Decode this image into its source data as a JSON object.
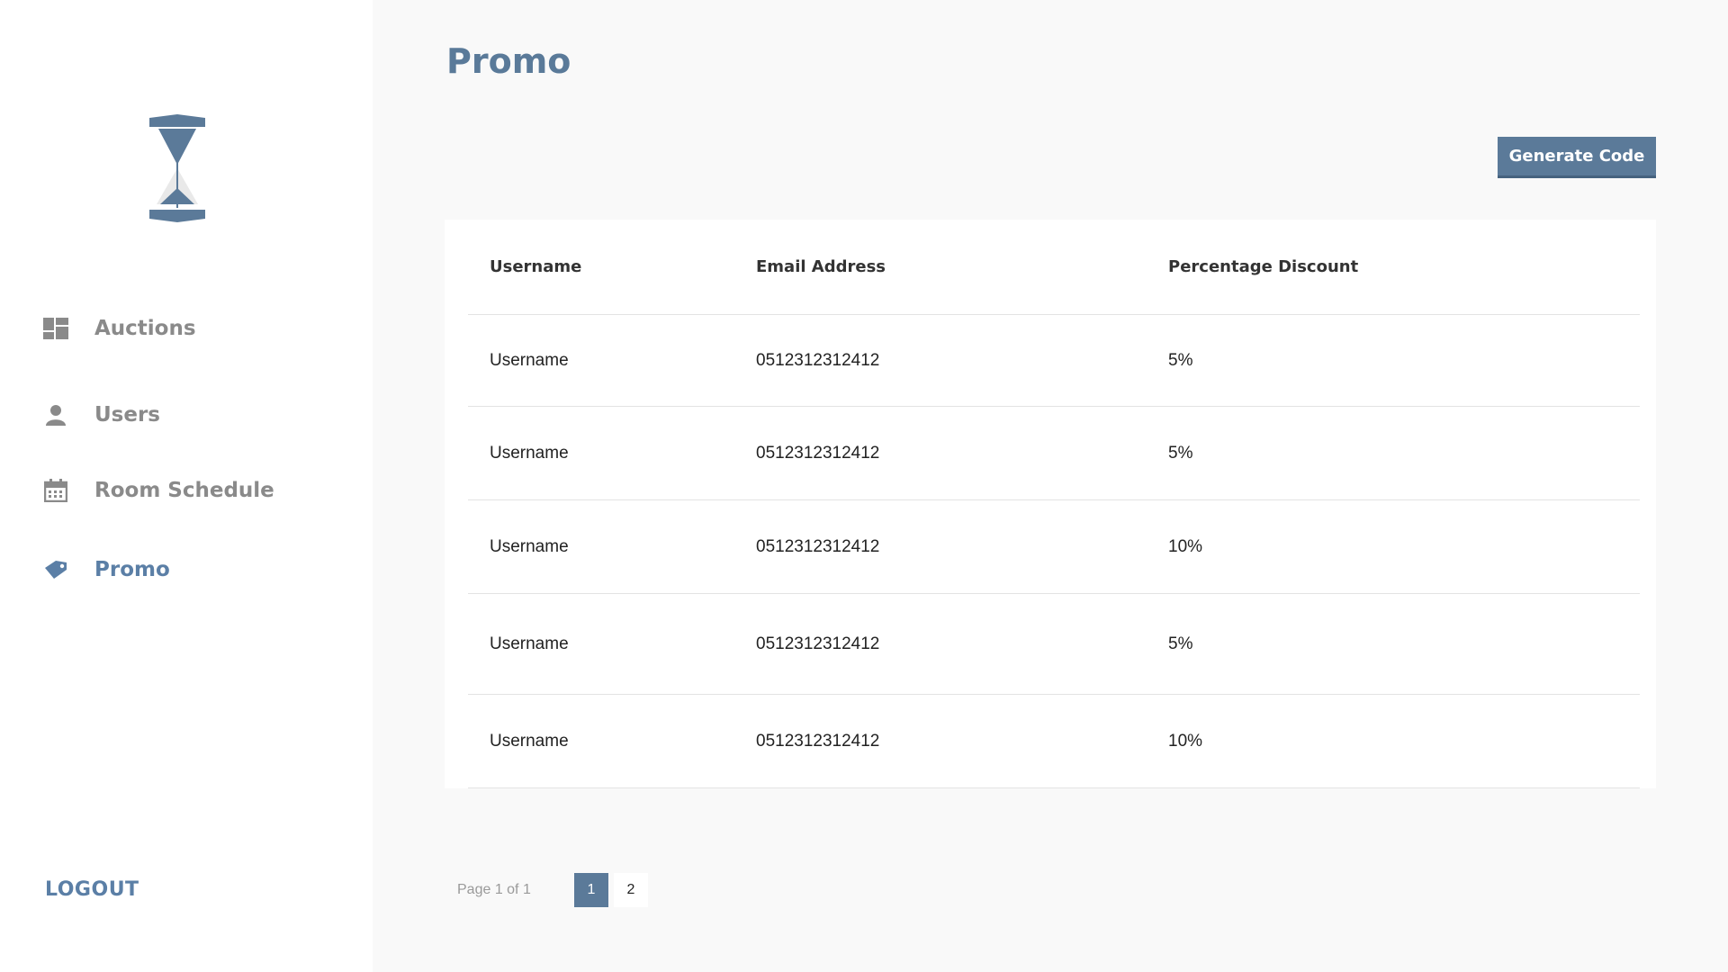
{
  "sidebar": {
    "logo": "hourglass-logo",
    "items": [
      {
        "label": "Auctions",
        "icon": "dashboard-icon",
        "active": false
      },
      {
        "label": "Users",
        "icon": "user-icon",
        "active": false
      },
      {
        "label": "Room Schedule",
        "icon": "calendar-icon",
        "active": false
      },
      {
        "label": "Promo",
        "icon": "tag-icon",
        "active": true
      }
    ],
    "logout_label": "LOGOUT"
  },
  "colors": {
    "accent": "#5b7fa6",
    "button": "#5b7a99",
    "muted_text": "#8a8a8a"
  },
  "page": {
    "title": "Promo",
    "generate_button_label": "Generate Code"
  },
  "table": {
    "headers": [
      "Username",
      "Email Address",
      "Percentage Discount"
    ],
    "rows": [
      [
        "Username",
        "0512312312412",
        "5%"
      ],
      [
        "Username",
        "0512312312412",
        "5%"
      ],
      [
        "Username",
        "0512312312412",
        "10%"
      ],
      [
        "Username",
        "0512312312412",
        "5%"
      ],
      [
        "Username",
        "0512312312412",
        "10%"
      ]
    ]
  },
  "pagination": {
    "summary": "Page 1 of 1",
    "pages": [
      "1",
      "2"
    ],
    "current": "1"
  }
}
